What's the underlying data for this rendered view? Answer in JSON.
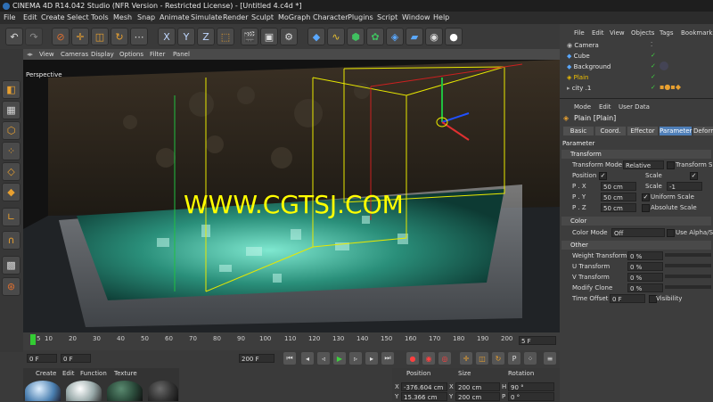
{
  "window": {
    "title": "CINEMA 4D R14.042 Studio (NFR Version - Restricted License) - [Untitled 4.c4d *]"
  },
  "menu": [
    "File",
    "Edit",
    "Create",
    "Select",
    "Tools",
    "Mesh",
    "Snap",
    "Animate",
    "Simulate",
    "Render",
    "Sculpt",
    "MoGraph",
    "Character",
    "Plugins",
    "Script",
    "Window",
    "Help"
  ],
  "viewport": {
    "menu": [
      "View",
      "Cameras",
      "Display",
      "Options",
      "Filter",
      "Panel"
    ],
    "label": "Perspective",
    "watermark": "WWW.CGTSJ.COM"
  },
  "timeline": {
    "ticks": [
      "5",
      "10",
      "20",
      "30",
      "40",
      "50",
      "60",
      "70",
      "80",
      "90",
      "100",
      "110",
      "120",
      "130",
      "140",
      "150",
      "160",
      "170",
      "180",
      "190",
      "200"
    ],
    "end_field": "5 F",
    "start_field": "0 F",
    "min_field": "0 F",
    "max_field": "200 F"
  },
  "material_manager": {
    "menu": [
      "Create",
      "Edit",
      "Function",
      "Texture"
    ]
  },
  "coordinates": {
    "headers": [
      "Position",
      "Size",
      "Rotation"
    ],
    "row_x": {
      "axis": "X",
      "pos": "-376.604 cm",
      "size_axis": "X",
      "size": "200 cm",
      "rot_axis": "H",
      "rot": "90 °"
    },
    "row_y": {
      "axis": "Y",
      "pos": "15.366 cm",
      "size_axis": "Y",
      "size": "200 cm",
      "rot_axis": "P",
      "rot": "0 °"
    }
  },
  "object_manager": {
    "menu": [
      "File",
      "Edit",
      "View",
      "Objects",
      "Tags",
      "Bookmarks"
    ],
    "objects": [
      "Camera",
      "Cube",
      "Background",
      "Plain",
      "city .1"
    ]
  },
  "attribute_manager": {
    "menu": [
      "Mode",
      "Edit",
      "User Data"
    ],
    "object_title": "Plain [Plain]",
    "tabs": [
      "Basic",
      "Coord.",
      "Effector",
      "Parameter",
      "Deform"
    ],
    "parameter_heading": "Parameter",
    "sections": {
      "transform": "Transform",
      "color": "Color",
      "other": "Other"
    },
    "transform": {
      "mode_label": "Transform Mode",
      "mode_value": "Relative",
      "transform_space_label": "Transform Spa",
      "position_label": "Position",
      "scale_label": "Scale",
      "px_label": "P . X",
      "px_value": "50 cm",
      "py_label": "P . Y",
      "py_value": "50 cm",
      "pz_label": "P . Z",
      "pz_value": "50 cm",
      "scale_sub_label": "Scale",
      "scale_value": "-1",
      "uniform_label": "Uniform Scale",
      "absolute_label": "Absolute Scale"
    },
    "color": {
      "mode_label": "Color Mode",
      "mode_value": "Off",
      "alpha_label": "Use Alpha/Str"
    },
    "other": {
      "weight_label": "Weight Transform",
      "weight_value": "0 %",
      "u_label": "U Transform",
      "u_value": "0 %",
      "v_label": "V Transform",
      "v_value": "0 %",
      "clone_label": "Modify Clone",
      "clone_value": "0 %",
      "offset_label": "Time Offset",
      "offset_value": "0 F",
      "visibility_label": "Visibility"
    }
  },
  "colors": {
    "accent_tab": "#4f7fb8",
    "active_object": "#f0c000",
    "watermark": "#ffff00",
    "playhead": "#33cc33"
  }
}
